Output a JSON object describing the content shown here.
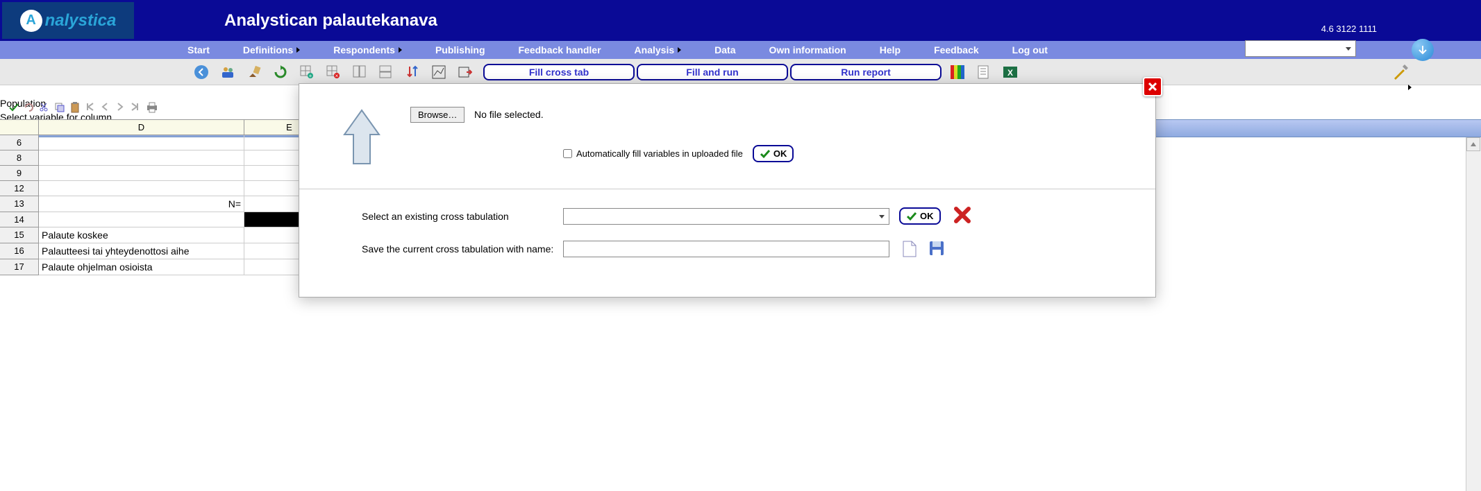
{
  "logo": "nalystica",
  "app_title": "Analystican palautekanava",
  "version": "4.6 3122 1111",
  "nav": {
    "start": "Start",
    "definitions": "Definitions",
    "respondents": "Respondents",
    "publishing": "Publishing",
    "feedback_handler": "Feedback handler",
    "analysis": "Analysis",
    "data": "Data",
    "own_info": "Own information",
    "help": "Help",
    "feedback": "Feedback",
    "logout": "Log out"
  },
  "toolbar": {
    "fill_cross": "Fill cross tab",
    "fill_run": "Fill and run",
    "run_report": "Run report"
  },
  "left": {
    "population": "Population",
    "select_var": "Select variable for column"
  },
  "sheet": {
    "col_D": "D",
    "col_E": "E",
    "rows": [
      "6",
      "8",
      "9",
      "12",
      "13",
      "14",
      "15",
      "16",
      "17"
    ],
    "n_label": "N=",
    "r15": "Palaute koskee",
    "r16": "Palautteesi tai yhteydenottosi aihe",
    "r17": "Palaute ohjelman osioista"
  },
  "modal": {
    "browse": "Browse…",
    "no_file": "No file selected.",
    "auto_fill": "Automatically fill variables in uploaded file",
    "ok": "OK",
    "select_existing": "Select an existing cross tabulation",
    "save_current": "Save the current cross tabulation with name:"
  }
}
